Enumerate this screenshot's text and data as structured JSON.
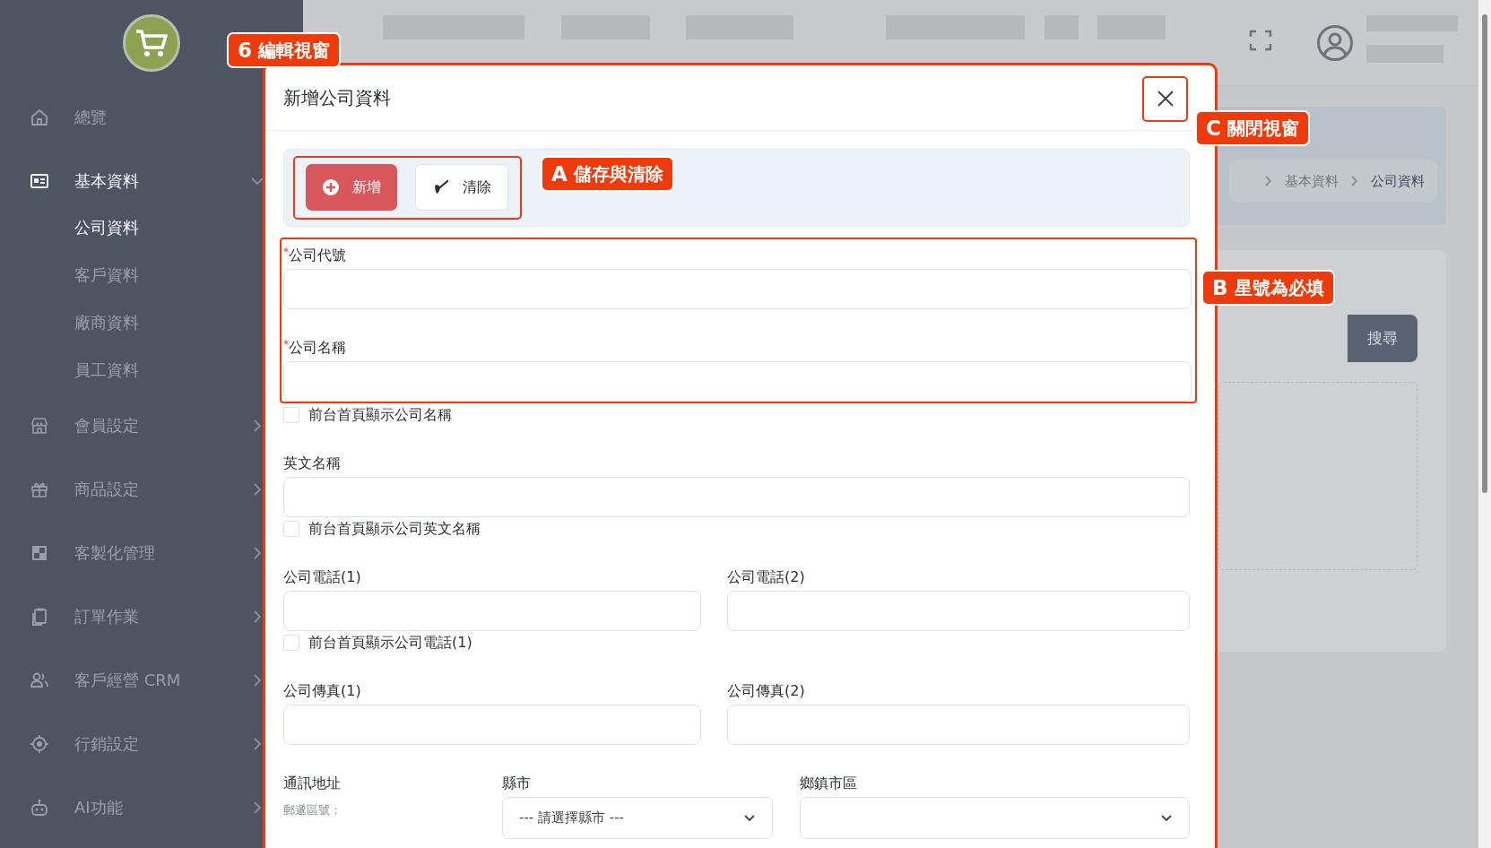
{
  "sidebar": {
    "items": [
      {
        "label": "總覽",
        "selected": false
      },
      {
        "label": "基本資料",
        "selected": true,
        "expanded": true,
        "children": [
          {
            "label": "公司資料",
            "selected": true
          },
          {
            "label": "客戶資料",
            "selected": false
          },
          {
            "label": "廠商資料",
            "selected": false
          },
          {
            "label": "員工資料",
            "selected": false
          }
        ]
      },
      {
        "label": "會員設定",
        "selected": false,
        "expanded": false
      },
      {
        "label": "商品設定",
        "selected": false,
        "expanded": false
      },
      {
        "label": "客製化管理",
        "selected": false,
        "expanded": false
      },
      {
        "label": "訂單作業",
        "selected": false,
        "expanded": false
      },
      {
        "label": "客戶經營 CRM",
        "selected": false,
        "expanded": false
      },
      {
        "label": "行銷設定",
        "selected": false,
        "expanded": false
      },
      {
        "label": "AI功能",
        "selected": false,
        "expanded": false
      }
    ]
  },
  "breadcrumb": [
    "基本資料",
    "公司資料"
  ],
  "search_button": "搜尋",
  "modal": {
    "title": "新增公司資料",
    "buttons": [
      {
        "label": "新增",
        "kind": "primary"
      },
      {
        "label": "清除",
        "kind": "secondary"
      }
    ],
    "rows": [
      {
        "fields": [
          {
            "label": "公司代號",
            "required_mark": "*",
            "kind": "text"
          }
        ]
      },
      {
        "fields": [
          {
            "label": "公司名稱",
            "required_mark": "*",
            "kind": "text"
          }
        ],
        "checkbox": {
          "label": "前台首頁顯示公司名稱",
          "checked": false
        }
      },
      {
        "fields": [
          {
            "label": "英文名稱",
            "kind": "text"
          }
        ],
        "checkbox": {
          "label": "前台首頁顯示公司英文名稱",
          "checked": false
        }
      },
      {
        "fields": [
          {
            "label": "公司電話(1)",
            "kind": "text"
          },
          {
            "label": "公司電話(2)",
            "kind": "text"
          }
        ],
        "checkbox": {
          "label": "前台首頁顯示公司電話(1)",
          "checked": false
        }
      },
      {
        "fields": [
          {
            "label": "公司傳真(1)",
            "kind": "text"
          },
          {
            "label": "公司傳真(2)",
            "kind": "text"
          }
        ]
      },
      {
        "fields": [
          {
            "label": "通訊地址",
            "kind": "note",
            "note": "郵遞區號："
          },
          {
            "label": "縣市",
            "kind": "select",
            "value": "--- 請選擇縣市 ---"
          },
          {
            "label": "鄉鎮市區",
            "kind": "select"
          }
        ]
      }
    ]
  },
  "annotations": [
    {
      "badge": "6",
      "text": "編輯視窗"
    },
    {
      "badge": "A",
      "text": "儲存與清除"
    },
    {
      "badge": "C",
      "text": "關閉視窗"
    },
    {
      "badge": "B",
      "text": "星號為必填"
    }
  ]
}
